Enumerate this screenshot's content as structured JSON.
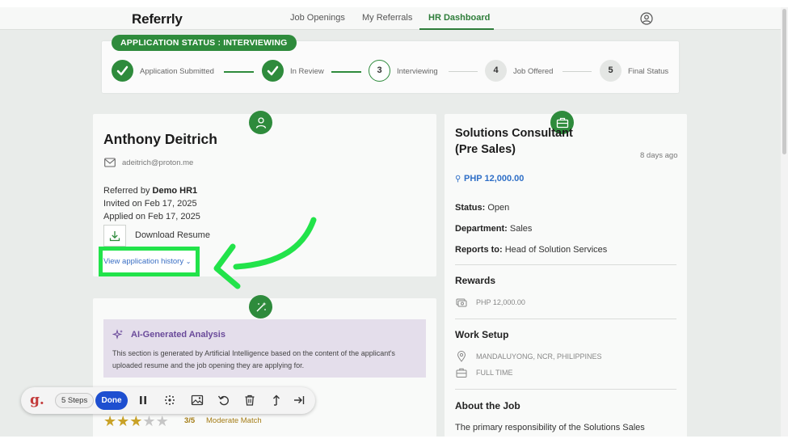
{
  "nav": {
    "logo": "Referrly",
    "links": [
      "Job Openings",
      "My Referrals",
      "HR Dashboard"
    ],
    "active": "HR Dashboard"
  },
  "status": {
    "pill": "APPLICATION STATUS : INTERVIEWING",
    "steps": [
      {
        "label": "Application Submitted",
        "state": "done"
      },
      {
        "label": "In Review",
        "state": "done"
      },
      {
        "label": "Interviewing",
        "number": "3",
        "state": "current"
      },
      {
        "label": "Job Offered",
        "number": "4",
        "state": "todo"
      },
      {
        "label": "Final Status",
        "number": "5",
        "state": "todo"
      }
    ]
  },
  "candidate": {
    "name": "Anthony Deitrich",
    "email": "adeitrich@proton.me",
    "referred_prefix": "Referred by ",
    "referred_by": "Demo HR1",
    "invited": "Invited on Feb 17, 2025",
    "applied": "Applied on Feb 17, 2025",
    "download_label": "Download Resume",
    "history_link": "View application history"
  },
  "analysis": {
    "title": "AI-Generated Analysis",
    "description": "This section is generated by Artificial Intelligence based on the content of the applicant's uploaded resume and the job opening they are applying for.",
    "rating": 3,
    "rating_max": 5,
    "score_text": "3/5",
    "match_text": "Moderate Match"
  },
  "toolbar": {
    "logo": "g.",
    "steps_label": "5 Steps",
    "done_label": "Done",
    "icons": [
      "pause-icon",
      "blur-icon",
      "image-icon",
      "undo-icon",
      "trash-icon",
      "share-icon",
      "skip-end-icon"
    ]
  },
  "job": {
    "title": "Solutions Consultant (Pre Sales)",
    "posted": "8 days ago",
    "salary": "PHP 12,000.00",
    "status_label": "Status:",
    "status_value": "Open",
    "department_label": "Department:",
    "department_value": "Sales",
    "reports_label": "Reports to:",
    "reports_value": "Head of Solution Services",
    "rewards_title": "Rewards",
    "reward_value": "PHP 12,000.00",
    "work_setup_title": "Work Setup",
    "location": "MANDALUYONG, NCR, PHILIPPINES",
    "employment": "FULL TIME",
    "about_title": "About the Job",
    "about_text": "The primary responsibility of the Solutions Sales"
  },
  "colors": {
    "brand_green": "#2e8b3c",
    "highlight": "#22e34a",
    "link_blue": "#3a6fc4",
    "done_blue": "#1e4fd0"
  }
}
